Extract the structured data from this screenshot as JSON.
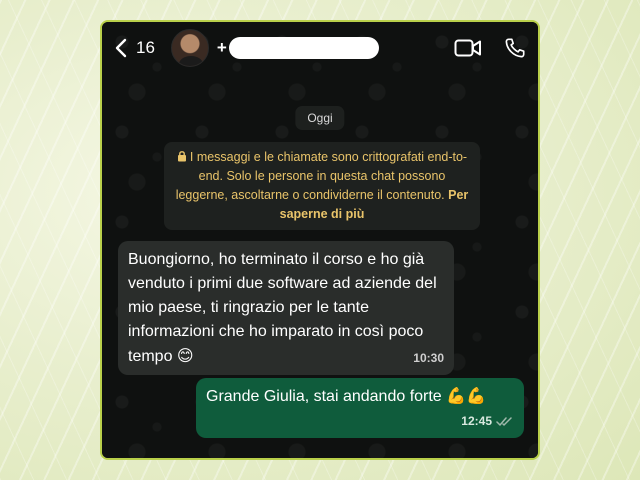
{
  "header": {
    "back_count": "16",
    "contact_prefix": "+",
    "icons": [
      "chevron-left-icon",
      "video-call-icon",
      "phone-icon"
    ]
  },
  "chat": {
    "day_label": "Oggi",
    "encryption_notice": {
      "text": "I messaggi e le chiamate sono crittografati end-to-end. Solo le persone in questa chat possono leggerne, ascoltarne o condividerne il contenuto.",
      "link": "Per saperne di più",
      "icon": "lock-icon"
    },
    "messages": [
      {
        "direction": "incoming",
        "text": "Buongiorno, ho terminato il corso e ho già venduto i primi due software ad aziende del mio paese, ti ringrazio per le tante informazioni che ho imparato in così poco tempo",
        "emoji": "😊",
        "time": "10:30"
      },
      {
        "direction": "outgoing",
        "text": "Grande Giulia, stai andando forte",
        "emoji": "💪💪",
        "time": "12:45",
        "status_icon": "double-check-icon"
      }
    ]
  },
  "colors": {
    "frame_border": "#b9d04a",
    "incoming_bubble": "#2a2d2b",
    "outgoing_bubble": "#0f5c3c",
    "notice_text": "#e9c46a"
  }
}
